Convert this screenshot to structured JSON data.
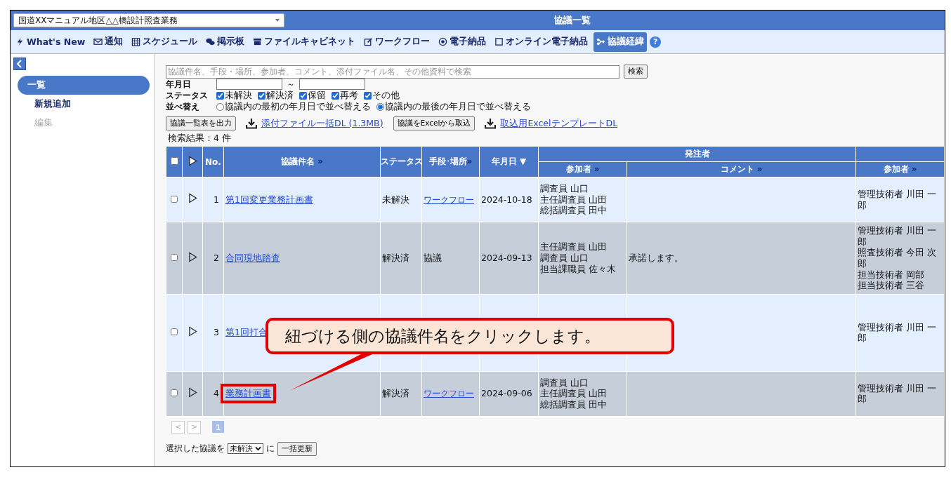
{
  "header": {
    "project": "国道XXマニュアル地区△△橋設計照査業務",
    "title": "協議一覧"
  },
  "nav": {
    "items": [
      {
        "label": "What's New",
        "selected": false
      },
      {
        "label": "通知",
        "selected": false
      },
      {
        "label": "スケジュール",
        "selected": false
      },
      {
        "label": "掲示板",
        "selected": false
      },
      {
        "label": "ファイルキャビネット",
        "selected": false
      },
      {
        "label": "ワークフロー",
        "selected": false
      },
      {
        "label": "電子納品",
        "selected": false
      },
      {
        "label": "オンライン電子納品",
        "selected": false
      },
      {
        "label": "協議経緯",
        "selected": true
      }
    ],
    "help": "?"
  },
  "sidebar": {
    "items": [
      {
        "label": "一覧",
        "selected": true,
        "disabled": false
      },
      {
        "label": "新規追加",
        "selected": false,
        "disabled": false
      },
      {
        "label": "編集",
        "selected": false,
        "disabled": true
      }
    ]
  },
  "filters": {
    "search_placeholder": "協議件名、手段・場所、参加者、コメント、添付ファイル名、その他資料で検索",
    "search_button": "検索",
    "date_label": "年月日",
    "date_separator": "～",
    "status_label": "ステータス",
    "statuses": [
      {
        "label": "未解決",
        "checked": true
      },
      {
        "label": "解決済",
        "checked": true
      },
      {
        "label": "保留",
        "checked": true
      },
      {
        "label": "再考",
        "checked": true
      },
      {
        "label": "その他",
        "checked": true
      }
    ],
    "sort_label": "並べ替え",
    "sorts": [
      {
        "label": "協議内の最初の年月日で並べ替える",
        "selected": false
      },
      {
        "label": "協議内の最後の年月日で並べ替える",
        "selected": true
      }
    ]
  },
  "actions": [
    {
      "kind": "button",
      "label": "協議一覧表を出力"
    },
    {
      "kind": "download",
      "label": "添付ファイル一括DL (1.3MB)"
    },
    {
      "kind": "button",
      "label": "協議をExcelから取込"
    },
    {
      "kind": "download",
      "label": "取込用ExcelテンプレートDL"
    }
  ],
  "result_count": "検索結果：4 件",
  "table": {
    "select_all_checked": false,
    "no_label": "No.",
    "title_label": "協議件名",
    "status_label": "ステータス",
    "means_label": "手段･場所",
    "date_label": "年月日",
    "date_sort": "▼",
    "client_group": "発注者",
    "participants_label": "参加者",
    "comment_label": "コメント",
    "contractor_participants_label": "参加者",
    "more": "»",
    "rows": [
      {
        "checked": false,
        "no": "1",
        "title": "第1回変更業務計画書",
        "status": "未解決",
        "means": "ワークフロー",
        "means_link": true,
        "date": "2024-10-18",
        "participants": [
          "調査員 山口",
          "主任調査員 山田",
          "総括調査員 田中"
        ],
        "contractor_participants": [
          "管理技術者 川田 一郎"
        ]
      },
      {
        "checked": false,
        "no": "2",
        "title": "合同現地踏査",
        "status": "解決済",
        "means": "協議",
        "means_link": false,
        "date": "2024-09-13",
        "participants": [
          "主任調査員 山田",
          "調査員 山口",
          "担当課職員 佐々木"
        ],
        "comment": "承諾します。",
        "contractor_participants": [
          "管理技術者 川田 一郎",
          "照査技術者 今田 次郎",
          "担当技術者 岡部",
          "担当技術者 三谷"
        ]
      },
      {
        "checked": false,
        "no": "3",
        "title": "第1回打合",
        "contractor_participants": [
          "管理技術者 川田 一郎"
        ]
      },
      {
        "checked": false,
        "no": "4",
        "title": "業務計画書",
        "highlighted": true,
        "status": "解決済",
        "means": "ワークフロー",
        "means_link": true,
        "date": "2024-09-06",
        "participants": [
          "調査員 山口",
          "主任調査員 山田",
          "総括調査員 田中"
        ],
        "contractor_participants": [
          "管理技術者 川田 一郎"
        ]
      }
    ]
  },
  "pagination": {
    "prev": "<",
    "next": ">",
    "pages": [
      {
        "label": "1",
        "selected": true
      }
    ]
  },
  "bulk": {
    "prefix": "選択した協議を",
    "value": "未解決",
    "suffix": "に",
    "button": "一括更新"
  },
  "callout": {
    "text": "紐づける側の協議件名をクリックします。"
  }
}
